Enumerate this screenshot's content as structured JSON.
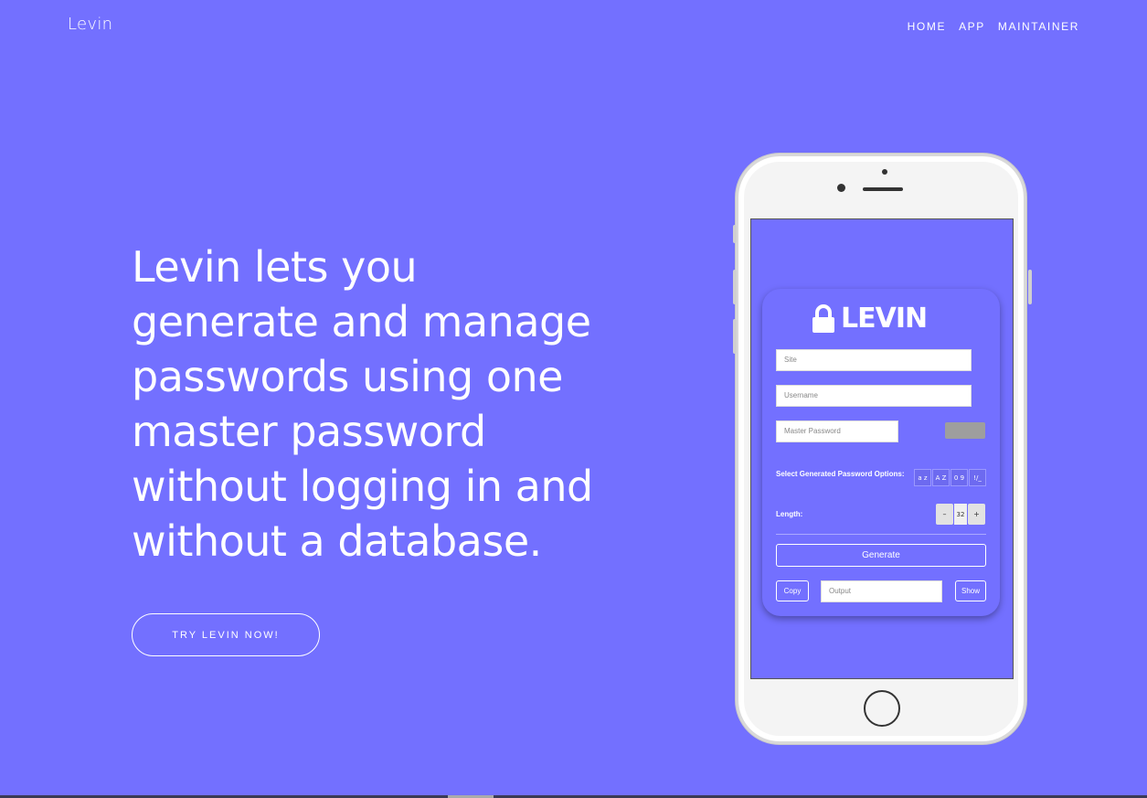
{
  "header": {
    "brand": "Levin",
    "nav": [
      "HOME",
      "APP",
      "MAINTAINER"
    ]
  },
  "hero": {
    "headline": "Levin lets you generate and manage passwords using one master password without logging in and without a database.",
    "cta_label": "TRY LEVIN NOW!"
  },
  "app": {
    "logo_text": "LEVIN",
    "site_placeholder": "Site",
    "username_placeholder": "Username",
    "master_placeholder": "Master Password",
    "options_label": "Select Generated Password Options:",
    "options": [
      "a z",
      "A Z",
      "0 9",
      "!/_"
    ],
    "length_label": "Length:",
    "length_minus": "–",
    "length_value": "32",
    "length_plus": "+",
    "generate_label": "Generate",
    "copy_label": "Copy",
    "output_placeholder": "Output",
    "show_label": "Show"
  },
  "colors": {
    "background": "#7370ff",
    "text": "#ffffff"
  }
}
